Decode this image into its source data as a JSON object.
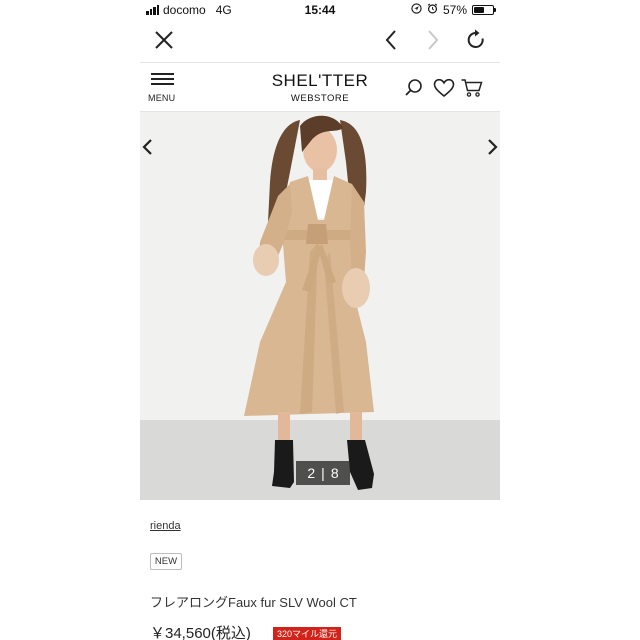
{
  "status_bar": {
    "carrier": "docomo",
    "network": "4G",
    "time": "15:44",
    "battery": "57%",
    "battery_level": 0.57
  },
  "browser": {
    "close_icon": "close-icon",
    "back_icon": "chevron-left-icon",
    "forward_icon": "chevron-right-icon",
    "reload_icon": "reload-icon"
  },
  "site_header": {
    "menu_label": "MENU",
    "logo_main": "SHEL'TTER",
    "logo_sub": "WEBSTORE",
    "icons": [
      "search-icon",
      "heart-icon",
      "cart-icon"
    ]
  },
  "gallery": {
    "current": "2",
    "separator": "|",
    "total": "8"
  },
  "product": {
    "brand": "rienda",
    "badge": "NEW",
    "name": "フレアロングFaux fur SLV Wool CT",
    "price": "￥34,560(税込)",
    "mile_badge": "320マイル還元"
  },
  "colors": {
    "accent_red": "#d2231a",
    "text": "#222222",
    "coat": "#d9b792",
    "gallery_bg": "#f1f1ef"
  }
}
